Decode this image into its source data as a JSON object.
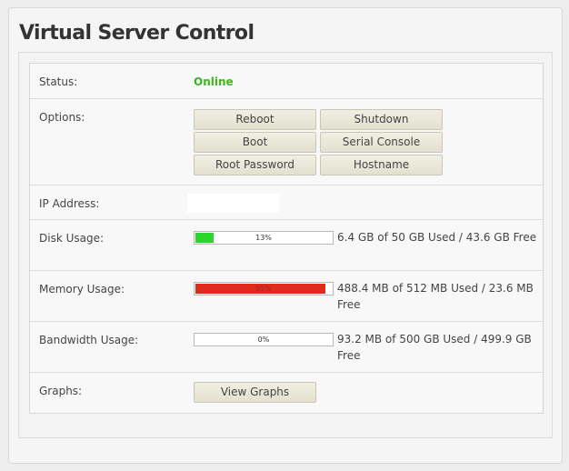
{
  "page": {
    "title": "Virtual Server Control"
  },
  "status": {
    "label": "Status:",
    "value": "Online"
  },
  "options": {
    "label": "Options:",
    "buttons": {
      "reboot": "Reboot",
      "shutdown": "Shutdown",
      "boot": "Boot",
      "serial_console": "Serial Console",
      "root_password": "Root Password",
      "hostname": "Hostname"
    }
  },
  "ip": {
    "label": "IP Address:",
    "value": ""
  },
  "disk": {
    "label": "Disk Usage:",
    "percent": 13,
    "percent_text": "13%",
    "text": "6.4 GB of 50 GB Used / 43.6 GB Free"
  },
  "memory": {
    "label": "Memory Usage:",
    "percent": 95,
    "percent_text": "95%",
    "text": "488.4 MB of 512 MB Used / 23.6 MB Free"
  },
  "bandwidth": {
    "label": "Bandwidth Usage:",
    "percent": 0,
    "percent_text": "0%",
    "text": "93.2 MB of 500 GB Used / 499.9 GB Free"
  },
  "graphs": {
    "label": "Graphs:",
    "button": "View Graphs"
  },
  "colors": {
    "online": "#3cb521",
    "bar_ok": "#2bd62b",
    "bar_critical": "#e02a1c"
  }
}
